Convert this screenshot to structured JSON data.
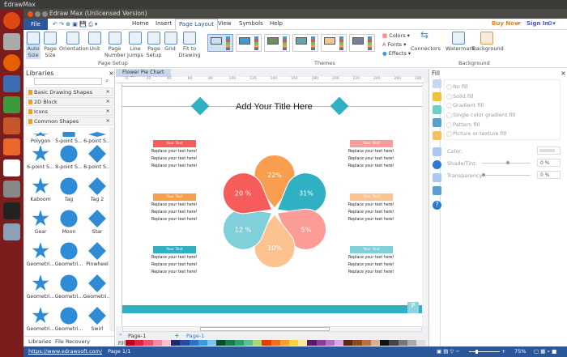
{
  "os": {
    "top_title": "EdrawMax"
  },
  "window": {
    "title": "Edraw Max (Unlicensed Version)"
  },
  "menu": {
    "file": "File",
    "tabs": [
      "Home",
      "Insert",
      "Page Layout",
      "View",
      "Symbols",
      "Help"
    ],
    "active": "Page Layout",
    "buy_now": "Buy Now",
    "sign_in": "Sign In"
  },
  "ribbon": {
    "page_setup": [
      "Auto Size",
      "Page Size",
      "Orientation",
      "Unit",
      "Page Number",
      "Line Jumps",
      "Page Setup",
      "Grid",
      "Fit to Drawing"
    ],
    "page_setup_group": "Page Setup",
    "themes_group": "Themes",
    "colors": "Colors",
    "fonts": "Fonts",
    "effects": "Effects",
    "connectors": "Connectors",
    "watermark": "Watermark",
    "background": "Background",
    "background_group": "Background"
  },
  "libraries": {
    "title": "Libraries",
    "categories": [
      "Basic Drawing Shapes",
      "2D Block",
      "Icons",
      "Common Shapes"
    ],
    "shapes": [
      "Polygon",
      "5-point S...",
      "6-point S...",
      "6-point S...",
      "8-point S...",
      "8-point S...",
      "Kaboom",
      "Tag",
      "Tag 2",
      "Gear",
      "Moon",
      "Star",
      "Geometri...",
      "Geometri...",
      "Pinwheel",
      "Geometri...",
      "Geometri...",
      "Geometri...",
      "Geometri...",
      "Geometri...",
      "Swirl"
    ],
    "bottom_tabs": [
      "Libraries",
      "File Recovery"
    ]
  },
  "document": {
    "tab": "Flower Pie Chart -...",
    "title": "Add Your Title Here",
    "ruler": [
      "0",
      "20",
      "40",
      "60",
      "80",
      "100",
      "120",
      "140",
      "160",
      "180",
      "200",
      "220",
      "240",
      "260",
      "280"
    ],
    "boxes": [
      {
        "label": "Your Text",
        "color": "#f65c5a"
      },
      {
        "label": "Your Text",
        "color": "#f99d4f"
      },
      {
        "label": "Your Text",
        "color": "#2fb0c3"
      },
      {
        "label": "Your Text",
        "color": "#fb9c97"
      },
      {
        "label": "Your Text",
        "color": "#fcc390"
      },
      {
        "label": "Your Text",
        "color": "#80cfd9"
      }
    ],
    "body_text": "Replace your text here!",
    "page_selector": "Page-1",
    "page_tab": "Page-1",
    "fill_label": "Fill"
  },
  "chart_data": {
    "type": "pie",
    "style": "flower",
    "labels": [
      "22%",
      "31%",
      "5%",
      "10%",
      "12 %",
      "20 %"
    ],
    "values": [
      22,
      31,
      5,
      10,
      12,
      20
    ],
    "colors": [
      "#f99d4f",
      "#2fb0c3",
      "#fb9c97",
      "#fcc390",
      "#80cfd9",
      "#f65c5a"
    ]
  },
  "fill_panel": {
    "title": "Fill",
    "options": [
      "No fill",
      "Solid fill",
      "Gradient fill",
      "Single color gradient fill",
      "Pattern fill",
      "Picture or texture fill"
    ],
    "color_label": "Color:",
    "shade_label": "Shade/Tint:",
    "shade_value": "0 %",
    "transparency_label": "Transparency:",
    "transparency_value": "0 %",
    "shade_level": 0.5,
    "transparency_level": 0
  },
  "status": {
    "url": "https://www.edrawsoft.com/",
    "page": "Page 1/1",
    "zoom": "75%"
  }
}
